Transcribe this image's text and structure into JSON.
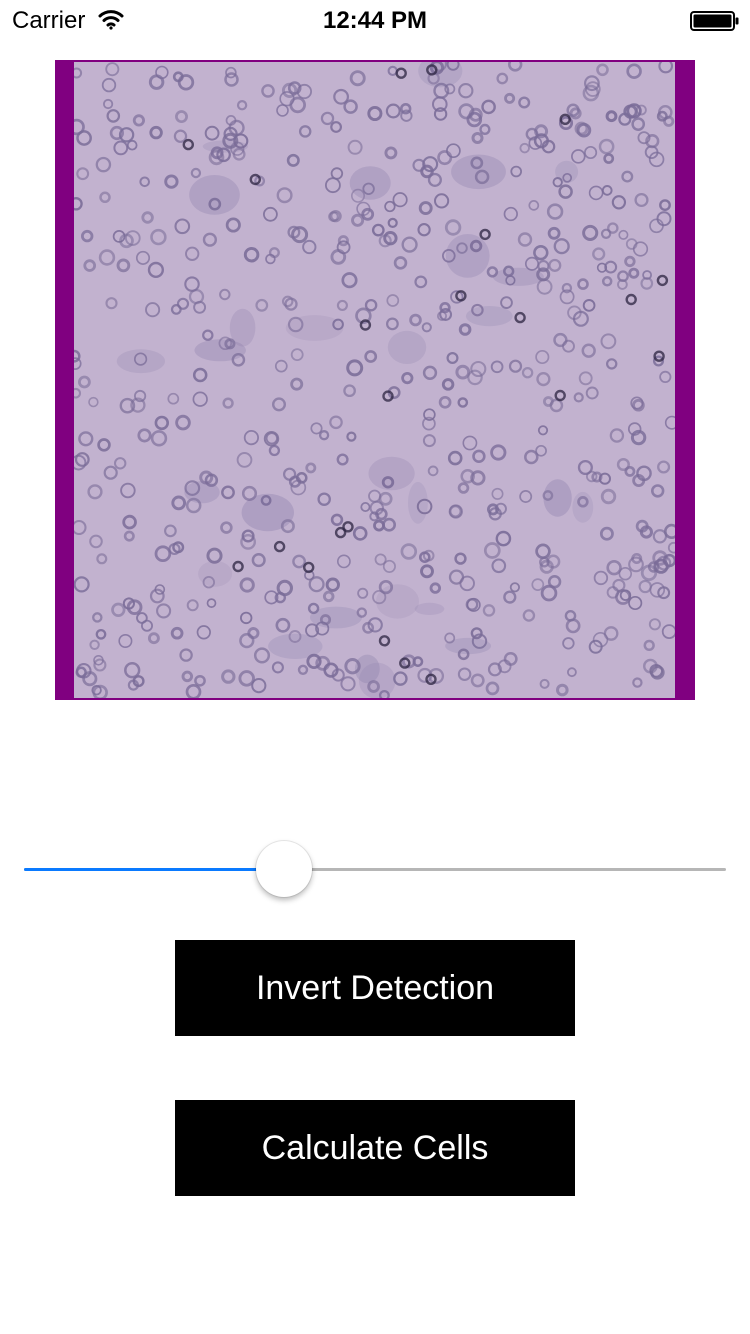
{
  "status_bar": {
    "carrier": "Carrier",
    "time": "12:44 PM",
    "icons": [
      "wifi-icon",
      "battery-icon"
    ]
  },
  "image_view": {
    "frame_color": "#800080",
    "background_color": "#c2b2cf",
    "cell_color": "#7a6c98"
  },
  "slider": {
    "value": 0.37,
    "min_track_color": "#0a7aff",
    "max_track_color": "#b6b6b6"
  },
  "buttons": {
    "invert_label": "Invert Detection",
    "calculate_label": "Calculate Cells"
  }
}
